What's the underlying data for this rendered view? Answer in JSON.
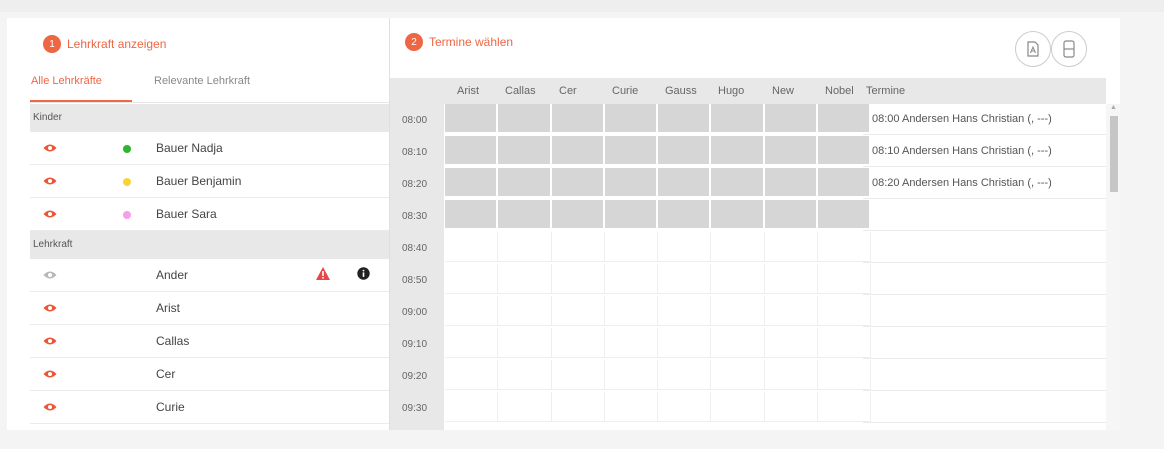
{
  "left": {
    "step_num": "1",
    "step_title": "Lehrkraft anzeigen",
    "tabs": [
      "Alle Lehrkräfte",
      "Relevante Lehrkraft"
    ],
    "section_children": "Kinder",
    "children": [
      {
        "name": "Bauer Nadja",
        "dot": "#2db52d"
      },
      {
        "name": "Bauer Benjamin",
        "dot": "#f5d43a"
      },
      {
        "name": "Bauer Sara",
        "dot": "#f79ee6"
      }
    ],
    "section_teachers": "Lehrkraft",
    "teachers": [
      "Ander",
      "Arist",
      "Callas",
      "Cer",
      "Curie"
    ]
  },
  "right": {
    "step_num": "2",
    "step_title": "Termine wählen",
    "columns": [
      "Arist",
      "Callas",
      "Cer",
      "Curie",
      "Gauss",
      "Hugo",
      "New",
      "Nobel"
    ],
    "termine_header": "Termine",
    "times": [
      "08:00",
      "08:10",
      "08:20",
      "08:30",
      "08:40",
      "08:50",
      "09:00",
      "09:10",
      "09:20",
      "09:30"
    ],
    "appointments": [
      "08:00 Andersen Hans Christian (, ---)",
      "08:10 Andersen Hans Christian (, ---)",
      "08:20 Andersen Hans Christian (, ---)"
    ],
    "busy_slots": 4
  },
  "icons": {
    "pdf": "pdf-icon",
    "print": "print-icon",
    "eye": "eye-icon",
    "warning": "warning-icon",
    "info": "info-icon"
  },
  "colors": {
    "accent": "#ee6644",
    "eye_active": "#ee5533",
    "eye_inactive": "#b8b8b8",
    "warning": "#e84646"
  }
}
